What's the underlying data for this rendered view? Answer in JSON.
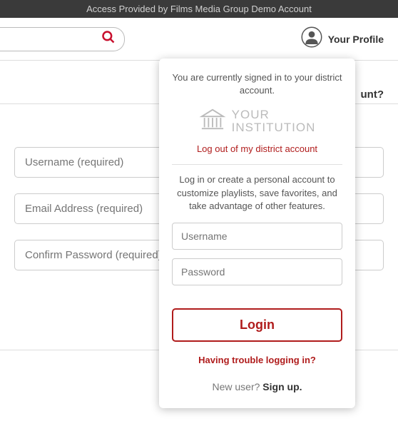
{
  "top_bar": "Access Provided by Films Media Group Demo Account",
  "profile_label": "Your Profile",
  "bg_question_fragment": "unt?",
  "bg_form": {
    "username_ph": "Username (required)",
    "email_ph": "Email Address (required)",
    "confirm_ph": "Confirm Password (required)"
  },
  "popup": {
    "signed_in_msg": "You are currently signed in to your district account.",
    "inst_line1": "YOUR",
    "inst_line2": "INSTITUTION",
    "logout": "Log out of my district account",
    "info_msg": "Log in or create a personal account to customize playlists, save favorites, and take advantage of other features.",
    "username_ph": "Username",
    "password_ph": "Password",
    "login_btn": "Login",
    "trouble": "Having trouble logging in?",
    "new_user_prefix": "New user? ",
    "signup": "Sign up."
  }
}
